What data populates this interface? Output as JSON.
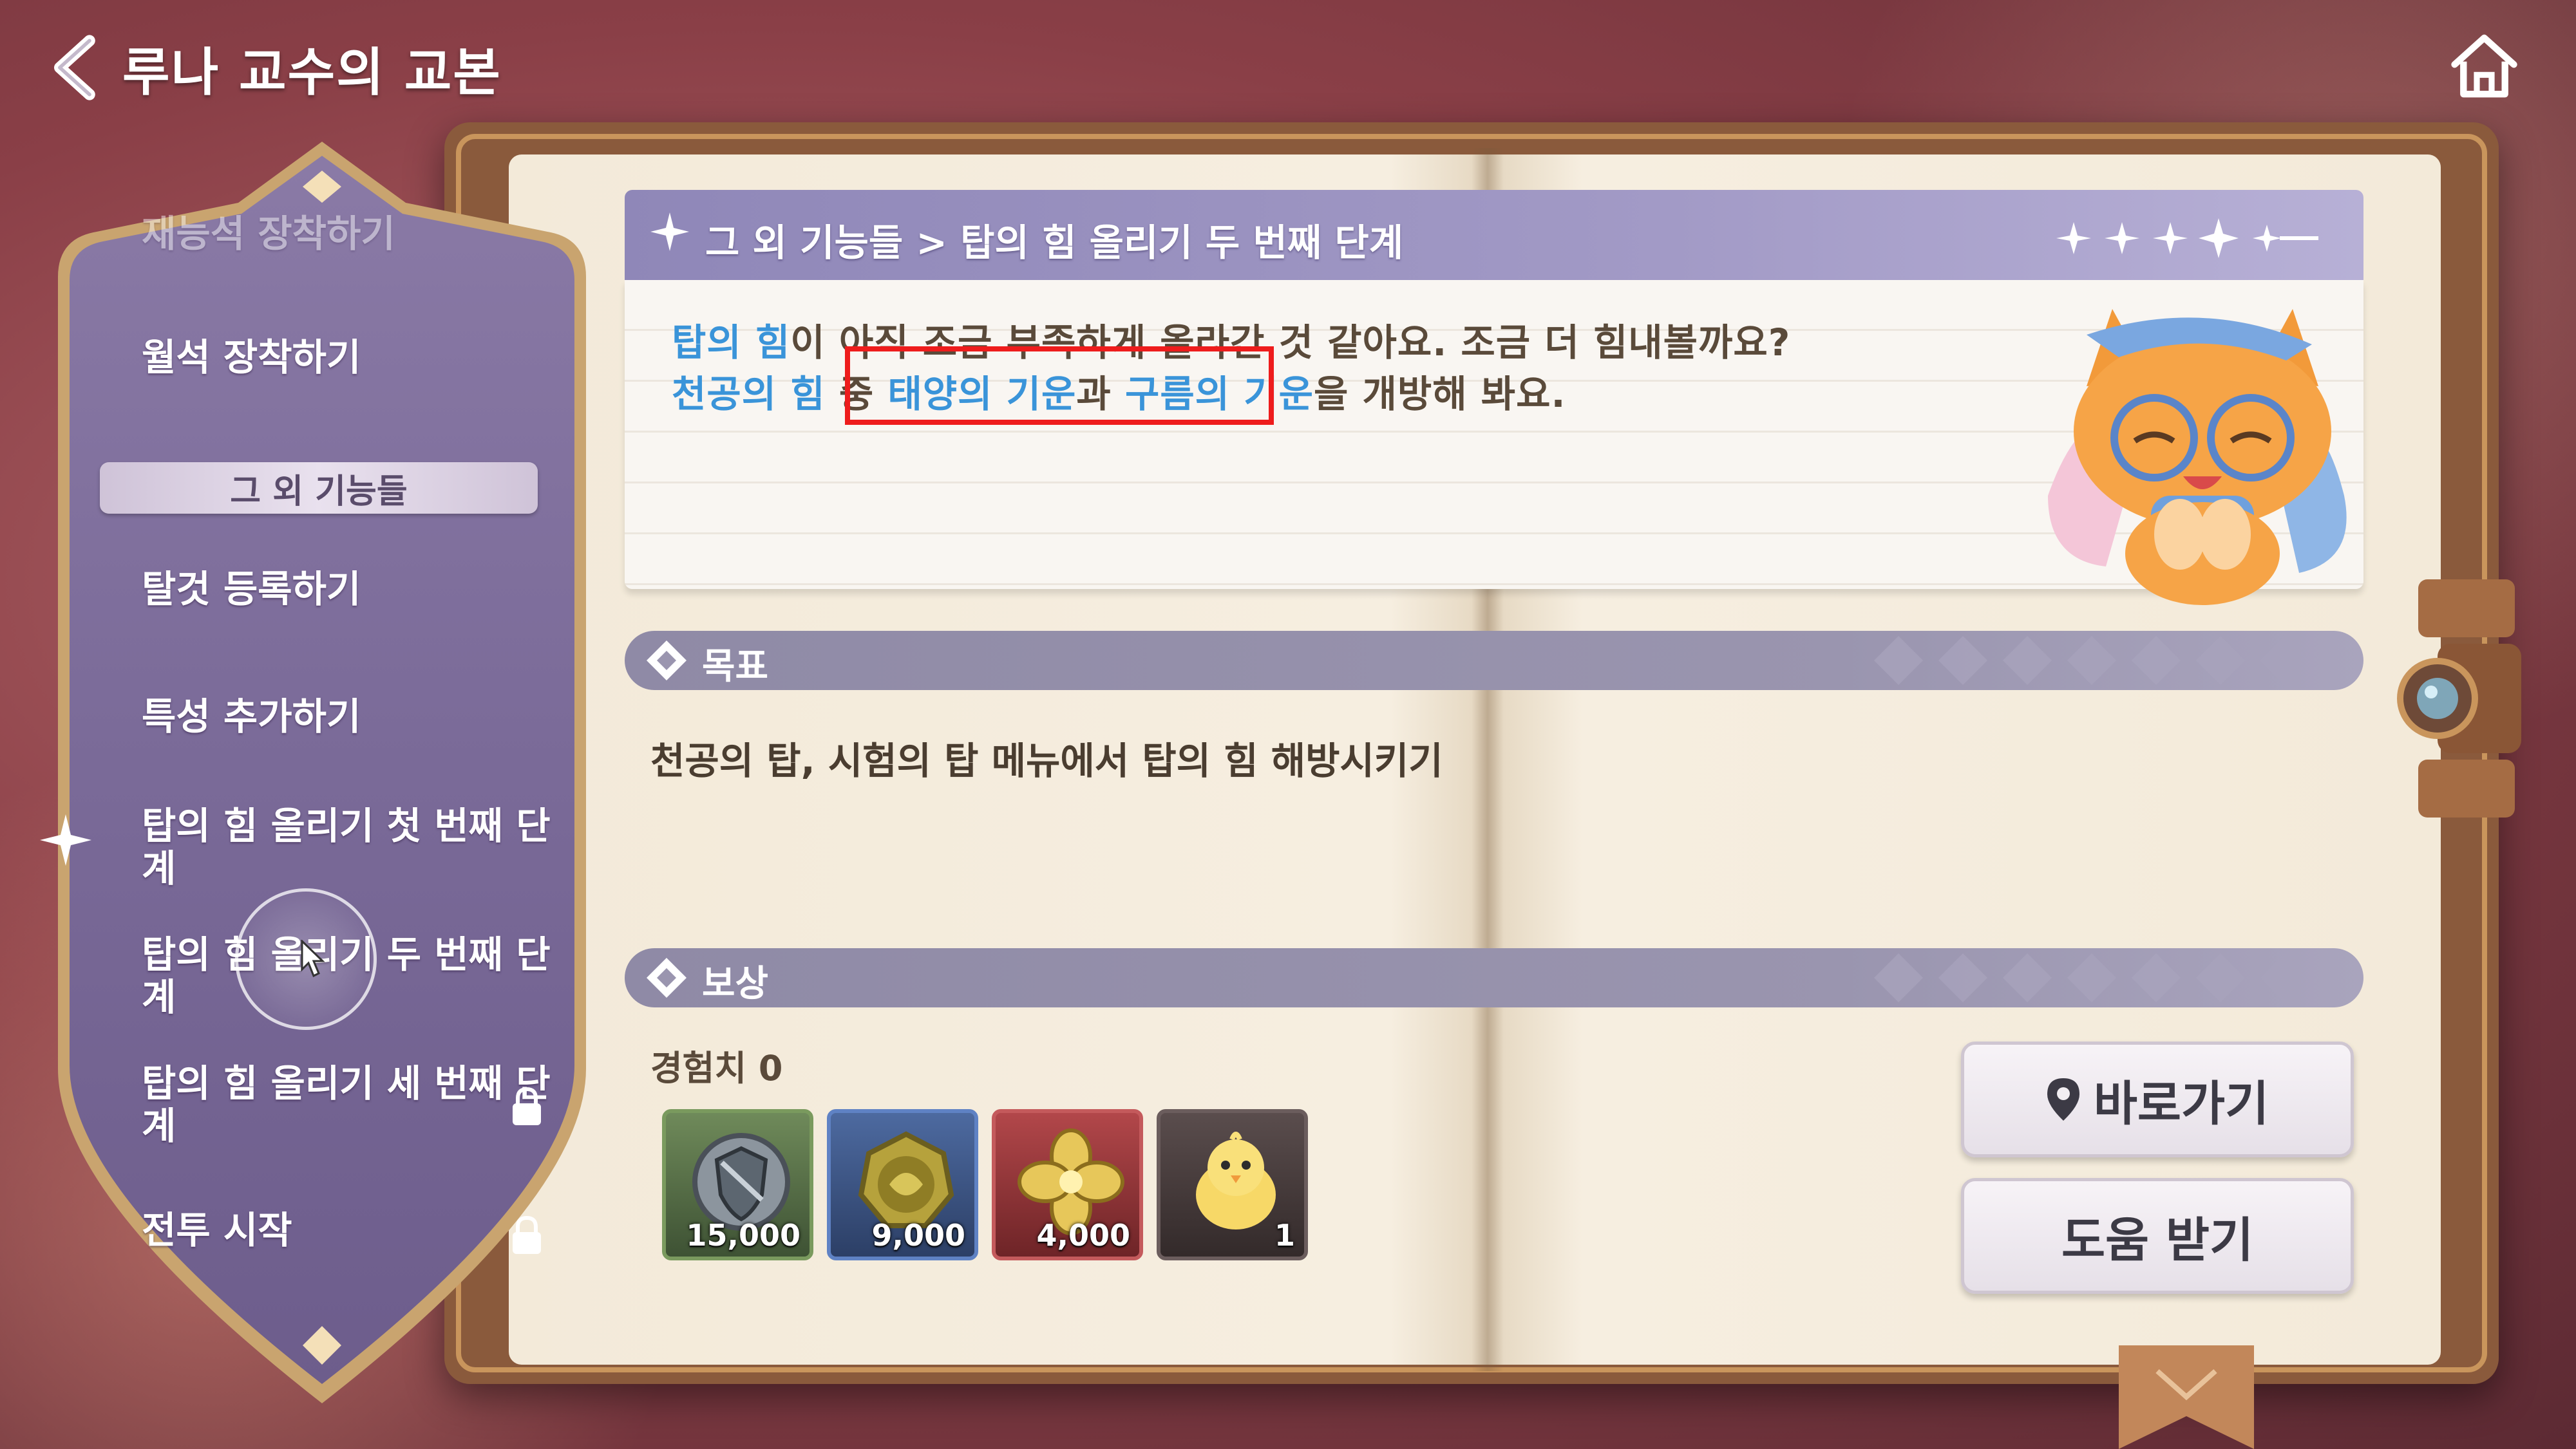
{
  "header": {
    "title": "루나 교수의 교본"
  },
  "sidebar": {
    "items": [
      {
        "label": "재능석 장착하기"
      },
      {
        "label": "월석 장착하기"
      },
      {
        "label": "그 외 기능들"
      },
      {
        "label": "탈것 등록하기"
      },
      {
        "label": "특성 추가하기"
      },
      {
        "label": "탑의 힘 올리기 첫 번째 단계"
      },
      {
        "label": "탑의 힘 올리기 두 번째 단계"
      },
      {
        "label": "탑의 힘 올리기 세 번째 단계"
      },
      {
        "label": "전투 시작"
      }
    ]
  },
  "main": {
    "breadcrumb": "그 외 기능들 > 탑의 힘 올리기 두 번째 단계",
    "dialog": {
      "line1_hl": "탑의 힘",
      "line1_rest": "이 아직 조금 부족하게 올라간 것 같아요. 조금 더 힘내볼까요?",
      "line2_hl1": "천공의 힘",
      "line2_mid1": " 중 ",
      "line2_hl2": "태양의 기운",
      "line2_mid2": "과 ",
      "line2_hl3": "구름의 기운",
      "line2_rest": "을 개방해 봐요."
    },
    "goal": {
      "title": "목표",
      "text": "천공의 탑, 시험의 탑 메뉴에서 탑의 힘 해방시키기"
    },
    "reward": {
      "title": "보상",
      "exp_label": "경험치 0",
      "items": [
        {
          "icon": "shield-token-icon",
          "count": "15,000"
        },
        {
          "icon": "dragon-coin-icon",
          "count": "9,000"
        },
        {
          "icon": "gold-clover-icon",
          "count": "4,000"
        },
        {
          "icon": "chick-icon",
          "count": "1"
        }
      ]
    },
    "buttons": {
      "goto": "바로가기",
      "help": "도움 받기"
    }
  },
  "colors": {
    "highlight_text": "#3a94d9",
    "annotation_box": "#ee1c1c",
    "section_bar": "#9a95af"
  }
}
